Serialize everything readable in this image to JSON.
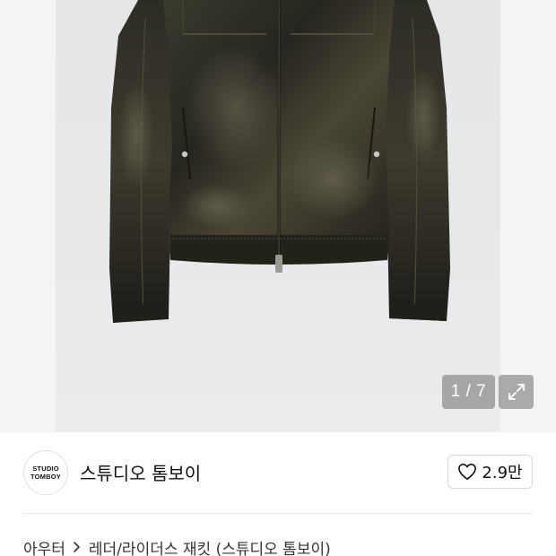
{
  "gallery": {
    "current_index": "1 / 7",
    "image_alt": "leather-rider-jacket"
  },
  "brand": {
    "logo_line1": "STUDIO",
    "logo_line2": "TOMBOY",
    "name": "스튜디오 톰보이",
    "likes": "2.9만"
  },
  "breadcrumb": {
    "category": "아우터",
    "subcategory": "레더/라이더스 재킷 (스튜디오 톰보이)"
  },
  "icons": {
    "expand": "expand-icon",
    "heart": "heart-icon",
    "chevron": "chevron-right-icon"
  },
  "colors": {
    "background": "#ffffff",
    "photo_bg": "#e8e8ea",
    "counter_bg": "#6e6e70",
    "jacket": "#2b2922",
    "text": "#111111"
  }
}
